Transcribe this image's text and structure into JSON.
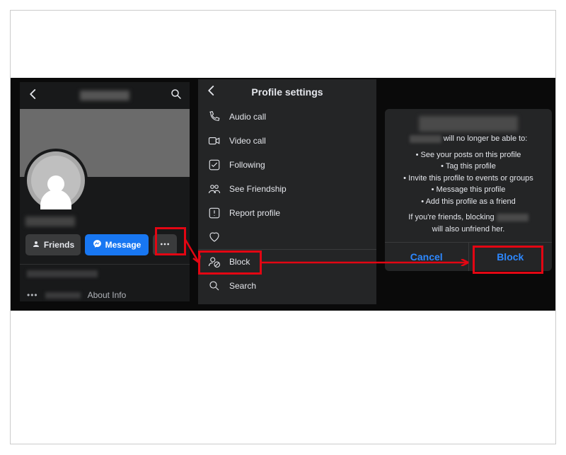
{
  "panel1": {
    "friends_label": "Friends",
    "message_label": "Message",
    "about_info_label": "About Info"
  },
  "panel2": {
    "title": "Profile settings",
    "items": [
      {
        "label": "Audio call"
      },
      {
        "label": "Video call"
      },
      {
        "label": "Following"
      },
      {
        "label": "See Friendship"
      },
      {
        "label": "Report profile"
      },
      {
        "label": ""
      },
      {
        "label": "Block"
      },
      {
        "label": "Search"
      }
    ]
  },
  "panel3": {
    "intro_suffix": " will no longer be able to:",
    "bullets": [
      "See your posts on this profile",
      "Tag this profile",
      "Invite this profile to events or groups",
      "Message this profile",
      "Add this profile as a friend"
    ],
    "friends_prefix": "If you're friends, blocking ",
    "friends_suffix": "will also unfriend her.",
    "cancel_label": "Cancel",
    "block_label": "Block"
  },
  "colors": {
    "highlight": "#e30613",
    "primary": "#1877f2"
  }
}
